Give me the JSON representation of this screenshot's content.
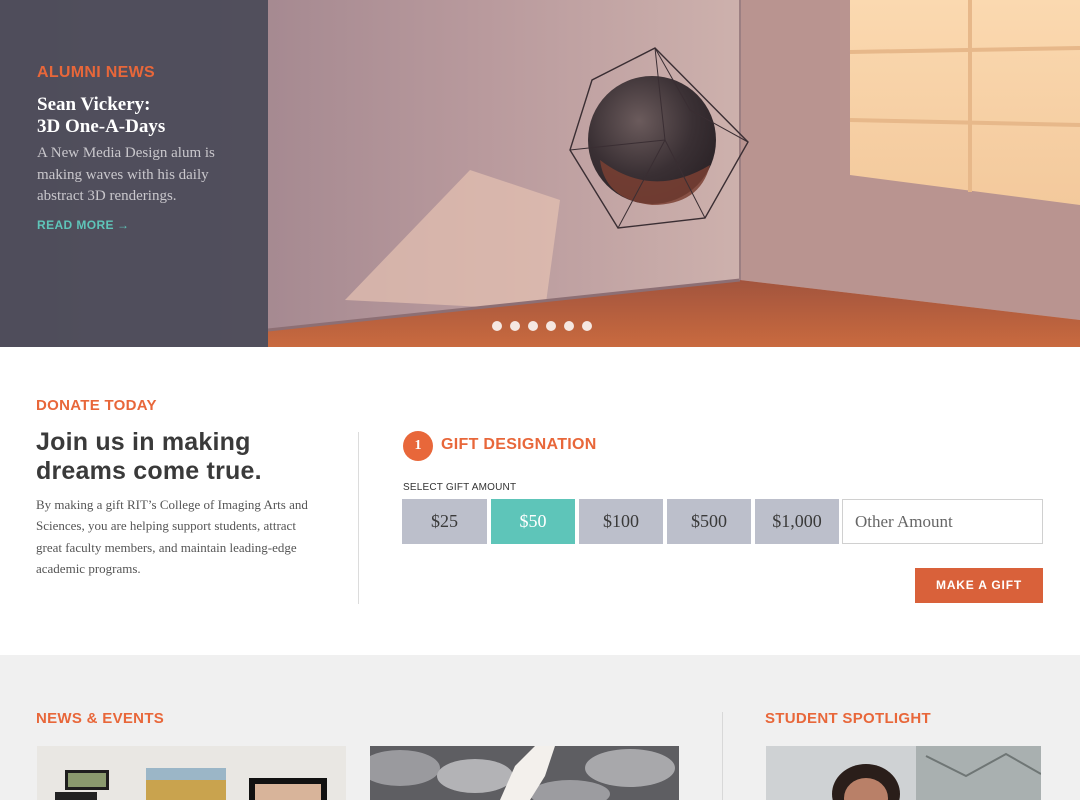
{
  "hero": {
    "kicker": "ALUMNI NEWS",
    "title": "Sean Vickery:\n3D One-A-Days",
    "description": "A New Media Design alum is making waves with his daily abstract 3D renderings.",
    "link_label": "READ MORE",
    "link_arrow": "→",
    "slide_count": 6
  },
  "donate": {
    "kicker": "DONATE TODAY",
    "heading": "Join us in making dreams come true.",
    "body": "By making a gift RIT’s College of Imaging Arts and Sciences, you are helping support students, attract great faculty members, and maintain leading-edge academic programs.",
    "step_number": "1",
    "step_title": "GIFT DESIGNATION",
    "amount_label": "SELECT GIFT AMOUNT",
    "amounts": [
      "$25",
      "$50",
      "$100",
      "$500",
      "$1,000"
    ],
    "selected_amount": "$50",
    "other_placeholder": "Other Amount",
    "submit_label": "MAKE A GIFT"
  },
  "news": {
    "kicker": "NEWS & EVENTS"
  },
  "spotlight": {
    "kicker": "STUDENT SPOTLIGHT"
  },
  "colors": {
    "accent": "#e8673a",
    "teal": "#5ec5b9",
    "panel": "#4a4a58",
    "button_gray": "#bcbfcb",
    "cta": "#d9613a"
  }
}
